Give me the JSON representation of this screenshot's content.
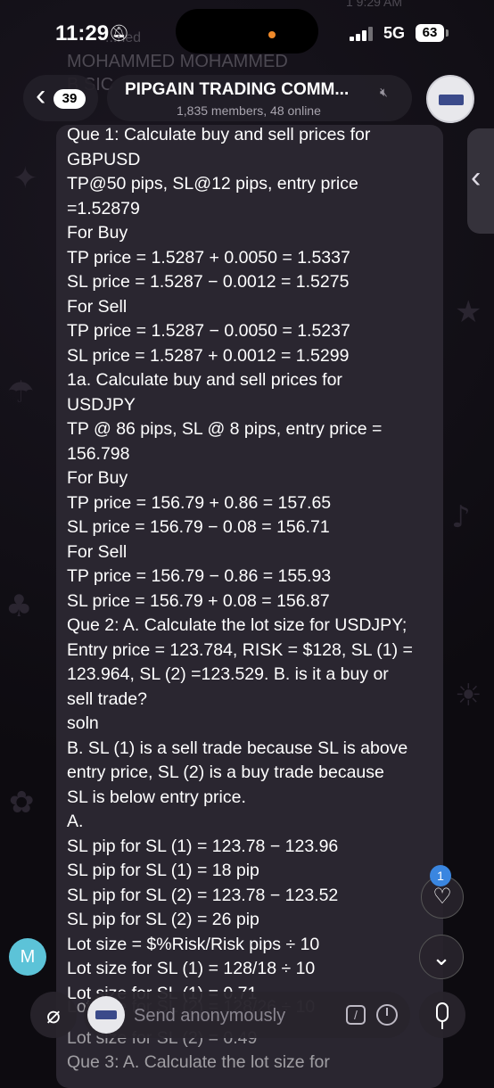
{
  "status_bar": {
    "time": "11:29",
    "network": "5G",
    "battery": "63"
  },
  "background": {
    "timestamp": "1 9:29 AM",
    "sender_line1": "...ned",
    "sender_line2": "MOHAMMED MOHAMMED",
    "sender_line3": "B SIC"
  },
  "header": {
    "unread_count": "39",
    "title": "PIPGAIN TRADING COMM...",
    "subtitle": "1,835 members, 48 online"
  },
  "message": {
    "lines": [
      "Que 1: Calculate buy and sell prices for",
      "GBPUSD",
      "TP@50 pips, SL@12 pips, entry price",
      "=1.52879",
      "For Buy",
      "TP price = 1.5287 + 0.0050 = 1.5337",
      "SL price = 1.5287 − 0.0012 = 1.5275",
      "For Sell",
      "TP price = 1.5287 − 0.0050 = 1.5237",
      "SL price = 1.5287 + 0.0012 = 1.5299",
      "1a. Calculate buy and sell prices for",
      "USDJPY",
      "TP @ 86 pips, SL @ 8 pips, entry price =",
      "156.798",
      "For Buy",
      "TP price = 156.79 + 0.86 = 157.65",
      "SL price = 156.79 − 0.08 = 156.71",
      "For Sell",
      "TP price = 156.79 − 0.86 = 155.93",
      "SL price = 156.79 + 0.08 = 156.87",
      "Que 2: A. Calculate the lot size for USDJPY;",
      "Entry price = 123.784, RISK = $128, SL (1) =",
      "123.964, SL (2) =123.529. B. is it a buy or",
      "sell trade?",
      "soln",
      "B. SL (1) is a sell trade because SL is above",
      "entry price, SL (2) is a buy trade because",
      "SL is below entry price.",
      "A.",
      "SL pip for SL (1) = 123.78 − 123.96",
      "SL pip for SL (1) = 18 pip",
      "SL pip for SL (2) = 123.78 − 123.52",
      "SL pip for SL (2) = 26 pip",
      "Lot size = $%Risk/Risk pips ÷ 10",
      "Lot size for SL (1) = 128/18 ÷ 10",
      "Lot size for SL (1) = 0.71"
    ],
    "obscured_lines": [
      "Lot size for SL (2) = 128/26 ÷ 10",
      "Lot size for SL (2) = 0.49",
      "Que 3: A. Calculate the lot size for"
    ]
  },
  "side": {
    "reaction_count": "1"
  },
  "sender_avatar_letter": "M",
  "composer": {
    "placeholder": "Send anonymously"
  },
  "icons": [
    "back-chevron-icon",
    "mute-icon",
    "group-avatar",
    "side-panel-chevron-icon",
    "heart-icon",
    "scroll-down-icon",
    "attach-icon",
    "command-icon",
    "schedule-icon",
    "mic-icon"
  ]
}
